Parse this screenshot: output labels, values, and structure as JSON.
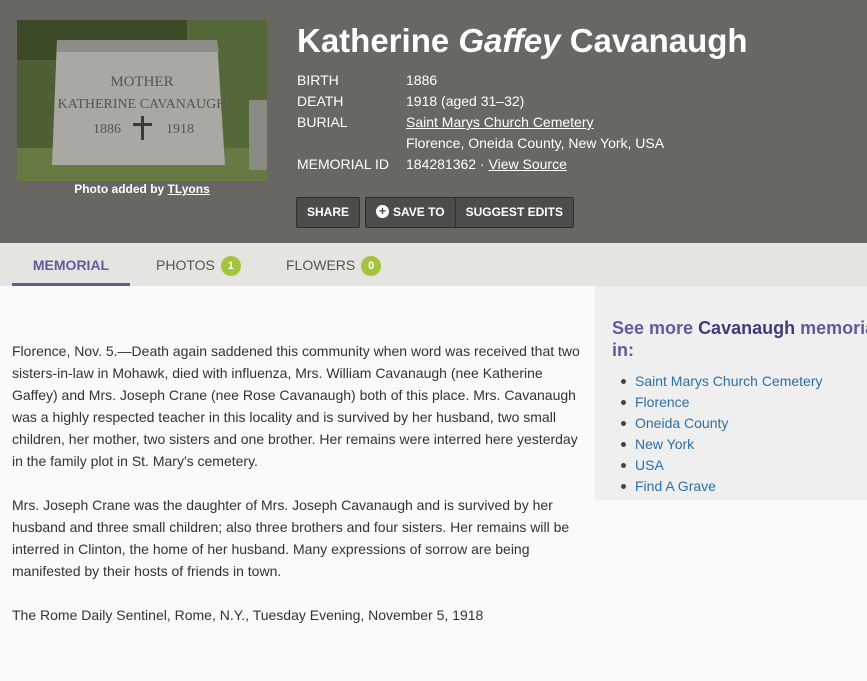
{
  "photo": {
    "epitaph_line1": "MOTHER",
    "epitaph_line2": "KATHERINE CAVANAUGH",
    "year_left": "1886",
    "year_right": "1918",
    "caption_prefix": "Photo added by",
    "caption_user": "TLyons"
  },
  "person": {
    "first": "Katherine",
    "maiden": "Gaffey",
    "last": "Cavanaugh"
  },
  "facts": {
    "birth_label": "BIRTH",
    "birth_value": "1886",
    "death_label": "DEATH",
    "death_value": "1918 (aged 31–32)",
    "burial_label": "BURIAL",
    "burial_cemetery": "Saint Marys Church Cemetery",
    "burial_location": "Florence, Oneida County, New York, USA",
    "memorial_label": "MEMORIAL ID",
    "memorial_id": "184281362 ·",
    "view_source": "View Source"
  },
  "actions": {
    "share": "SHARE",
    "save": "SAVE TO",
    "suggest": "SUGGEST EDITS"
  },
  "tabs": [
    {
      "label": "MEMORIAL"
    },
    {
      "label": "PHOTOS",
      "count": "1"
    },
    {
      "label": "FLOWERS",
      "count": "0"
    }
  ],
  "bio": [
    "Florence, Nov. 5.—Death again saddened this community when word was received that two sisters-in-law in Mohawk, died with influenza, Mrs. William Cavanaugh (nee Katherine Gaffey) and Mrs. Joseph Crane (nee Rose Cavanaugh) both of this place. Mrs. Cavanaugh was a highly respected teacher in this locality and is survived by her husband, two small children, her mother, two sisters and one brother. Her remains were interred here yesterday in the family plot in St. Mary's cemetery.",
    "Mrs. Joseph Crane was the daughter of Mrs. Joseph Cavanaugh and is survived by her husband and three small children; also three brothers and four sisters. Her remains will be interred in Clinton, the home of her husband. Many expressions of sorrow are being manifested by their hosts of friends in town.",
    "The Rome Daily Sentinel, Rome, N.Y., Tuesday Evening, November 5, 1918"
  ],
  "sidebar": {
    "title_prefix": "See more",
    "title_surname": "Cavanaugh",
    "title_suffix": "memorials in:",
    "links": [
      "Saint Marys Church Cemetery",
      "Florence",
      "Oneida County",
      "New York",
      "USA",
      "Find A Grave"
    ]
  },
  "colors": {
    "header_bg": "#696764",
    "accent": "#5f5b9c",
    "badge": "#a2c43f",
    "link": "#2d6fa3"
  }
}
